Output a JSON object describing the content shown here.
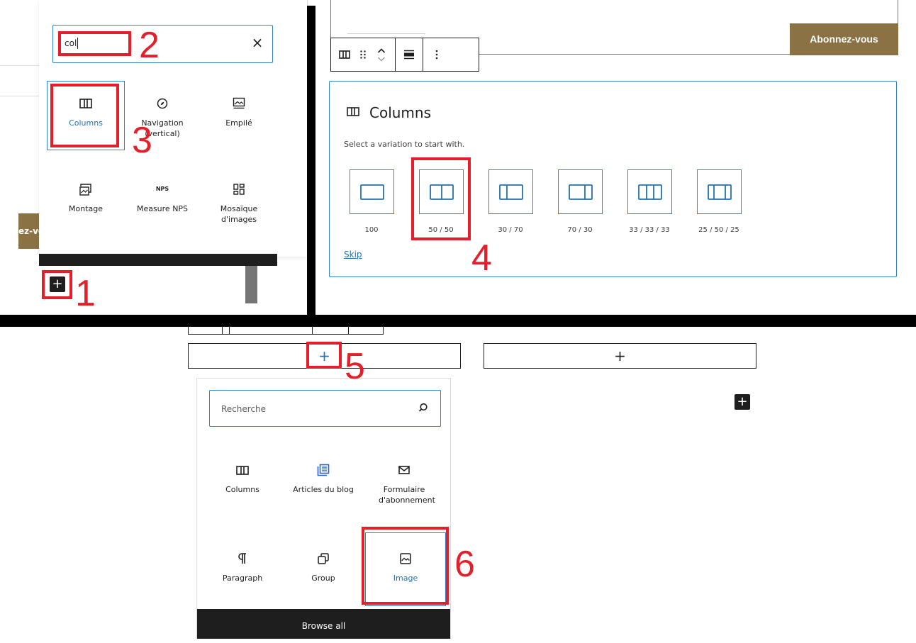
{
  "colors": {
    "accent": "#3582c4",
    "brand": "#8b7244",
    "annotation": "#e3202a",
    "dark": "#1e1e1e"
  },
  "panel1": {
    "search_value": "col",
    "clear_icon": "close-icon",
    "results": [
      {
        "label": "Columns",
        "icon": "columns-icon"
      },
      {
        "label": "Navigation (vertical)",
        "icon": "compass-icon"
      },
      {
        "label": "Empilé",
        "icon": "stack-icon"
      },
      {
        "label": "Montage",
        "icon": "gallery-icon"
      },
      {
        "label": "Measure NPS",
        "icon": "nps-icon",
        "icon_text": "NPS"
      },
      {
        "label": "Mosaïque d'images",
        "icon": "mosaic-icon"
      }
    ],
    "brand_peek": "ez-vo",
    "add_block": "+"
  },
  "panel2": {
    "subscribe_label": "Abonnez-vous",
    "toolbar_icons": [
      "columns-icon",
      "drag-handle-icon",
      "move-up-icon",
      "move-down-icon",
      "align-icon",
      "more-options-icon"
    ],
    "title": "Columns",
    "instructions": "Select a variation to start with.",
    "variations": [
      "100",
      "50 / 50",
      "30 / 70",
      "70 / 30",
      "33 / 33 / 33",
      "25 / 50 / 25"
    ],
    "skip": "Skip"
  },
  "panel3": {
    "appender": "+",
    "search_placeholder": "Recherche",
    "blocks": [
      {
        "label": "Columns",
        "icon": "columns-icon"
      },
      {
        "label": "Articles du blog",
        "icon": "post-list-icon"
      },
      {
        "label": "Formulaire d'abonnement",
        "icon": "envelope-icon"
      },
      {
        "label": "Paragraph",
        "icon": "paragraph-icon"
      },
      {
        "label": "Group",
        "icon": "group-icon"
      },
      {
        "label": "Image",
        "icon": "image-icon"
      }
    ],
    "browse_all": "Browse all"
  },
  "annotations": [
    "1",
    "2",
    "3",
    "4",
    "5",
    "6"
  ]
}
